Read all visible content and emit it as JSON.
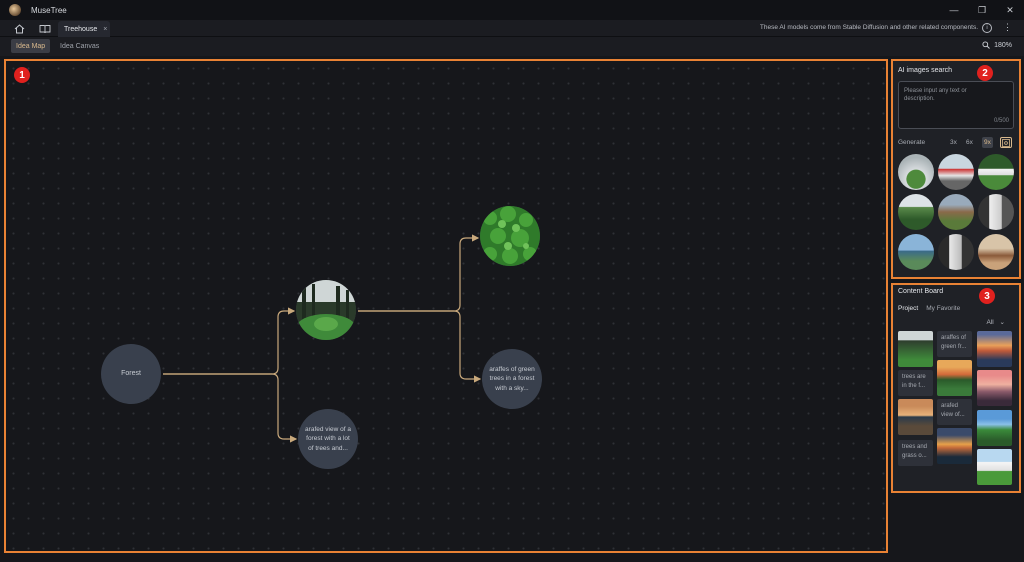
{
  "app": {
    "title": "MuseTree",
    "icon": "musetree-logo-icon"
  },
  "window_controls": {
    "minimize": "—",
    "restore": "❐",
    "close": "✕"
  },
  "tabbar": {
    "home_icon": "home-icon",
    "library_icon": "book-icon",
    "tab_label": "Treehouse",
    "tab_close": "×",
    "notice": "These AI models come from Stable Diffusion and other related components.",
    "info_glyph": "i",
    "more_glyph": "⋮"
  },
  "modes": {
    "idea_map": "Idea Map",
    "idea_canvas": "Idea Canvas",
    "active": "Idea Map"
  },
  "zoom": {
    "label": "180%",
    "icon": "zoom-icon"
  },
  "badges": {
    "canvas": "1",
    "ai_search": "2",
    "content_board": "3"
  },
  "canvas": {
    "nodes": {
      "root": "Forest",
      "child_text": "arafed view of a forest with a lot of trees and...",
      "grandchild_text": "araffes of green trees in a forest with a sky..."
    }
  },
  "ai_search": {
    "title": "AI images search",
    "placeholder": "Please input any text or description.",
    "counter": "0/500",
    "generate_label": "Generate",
    "options": [
      "3x",
      "6x",
      "9x"
    ],
    "selected_option": "9x"
  },
  "content_board": {
    "title": "Content Board",
    "tabs": [
      "Project",
      "My Favorite"
    ],
    "active_tab": "Project",
    "filter": "All",
    "text_tiles": [
      "araffes of green fr...",
      "trees are in the f...",
      "arafed view of...",
      "trees and grass o..."
    ]
  },
  "colors": {
    "accent": "#d9b98d",
    "highlight_border": "#e98234",
    "badge": "#e0211e",
    "node": "#39404d"
  }
}
